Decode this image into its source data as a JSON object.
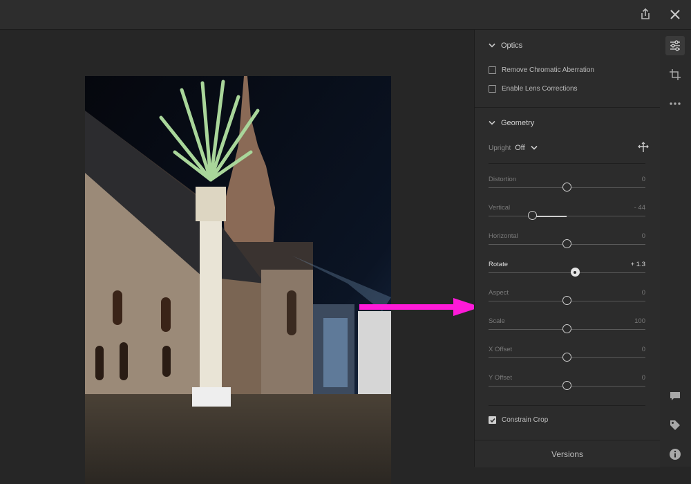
{
  "optics": {
    "title": "Optics",
    "remove_ca": {
      "label": "Remove Chromatic Aberration",
      "checked": false
    },
    "lens_corr": {
      "label": "Enable Lens Corrections",
      "checked": false
    }
  },
  "geometry": {
    "title": "Geometry",
    "upright_label": "Upright",
    "upright_value": "Off",
    "sliders": [
      {
        "label": "Distortion",
        "value": "0",
        "pos": 0.5,
        "active": false
      },
      {
        "label": "Vertical",
        "value": "- 44",
        "pos": 0.28,
        "active": false
      },
      {
        "label": "Horizontal",
        "value": "0",
        "pos": 0.5,
        "active": false
      },
      {
        "label": "Rotate",
        "value": "+ 1.3",
        "pos": 0.555,
        "active": true
      },
      {
        "label": "Aspect",
        "value": "0",
        "pos": 0.5,
        "active": false
      },
      {
        "label": "Scale",
        "value": "100",
        "pos": 0.5,
        "active": false
      },
      {
        "label": "X Offset",
        "value": "0",
        "pos": 0.5,
        "active": false
      },
      {
        "label": "Y Offset",
        "value": "0",
        "pos": 0.5,
        "active": false
      }
    ],
    "constrain_crop": {
      "label": "Constrain Crop",
      "checked": true
    }
  },
  "versions_label": "Versions",
  "icons": {
    "share": "share-icon",
    "close": "close-icon",
    "edit": "sliders-icon",
    "crop": "crop-icon",
    "more": "more-icon",
    "comment": "comment-icon",
    "tag": "tag-icon",
    "info": "info-icon"
  },
  "colors": {
    "accent_arrow": "#ff1ad9",
    "panel_bg": "#2c2c2c"
  }
}
